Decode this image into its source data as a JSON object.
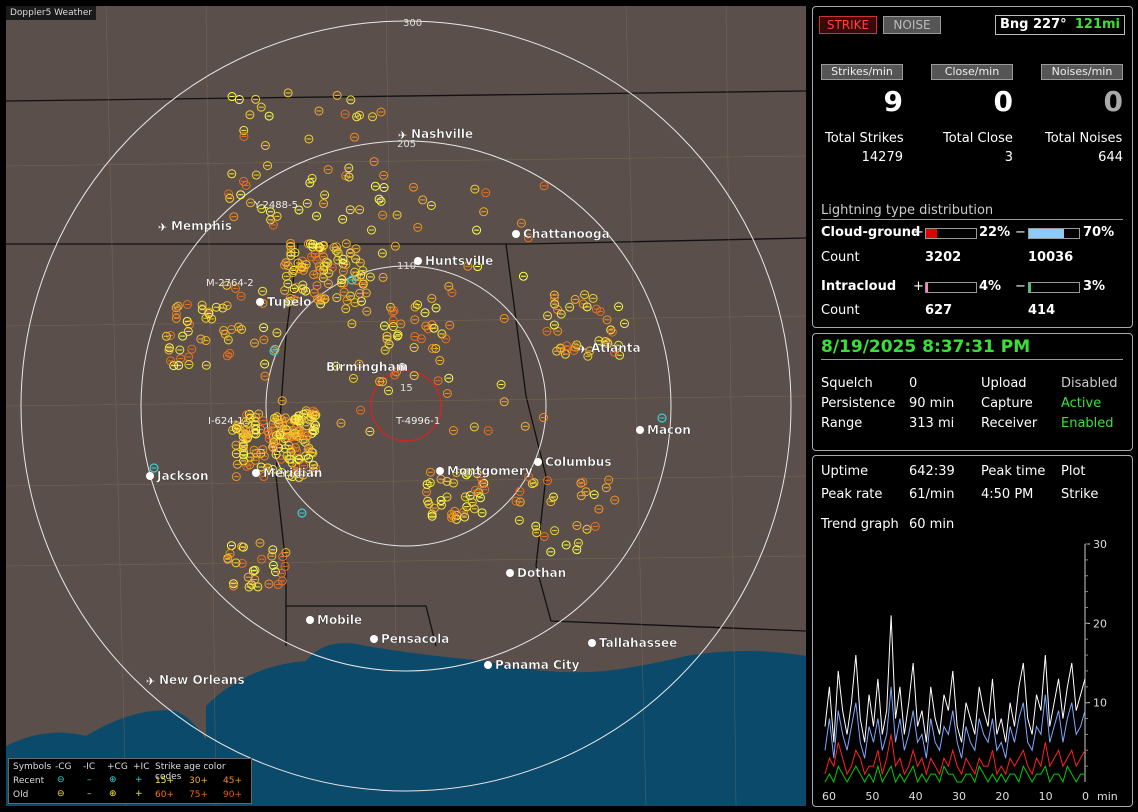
{
  "app_title": "Doppler5 Weather",
  "map": {
    "range_labels": [
      "300",
      "205",
      "110",
      "15"
    ],
    "cities": [
      {
        "name": "Nashville",
        "type": "airport"
      },
      {
        "name": "Memphis",
        "type": "airport"
      },
      {
        "name": "Chattanooga",
        "type": "city"
      },
      {
        "name": "Huntsville",
        "type": "city"
      },
      {
        "name": "Tupelo",
        "type": "city"
      },
      {
        "name": "Atlanta",
        "type": "airport"
      },
      {
        "name": "Birmingham",
        "type": "city"
      },
      {
        "name": "Macon",
        "type": "city"
      },
      {
        "name": "Jackson",
        "type": "city"
      },
      {
        "name": "Meridian",
        "type": "city"
      },
      {
        "name": "Montgomery",
        "type": "city"
      },
      {
        "name": "Columbus",
        "type": "city"
      },
      {
        "name": "Dothan",
        "type": "city"
      },
      {
        "name": "Mobile",
        "type": "city"
      },
      {
        "name": "Pensacola",
        "type": "city"
      },
      {
        "name": "Tallahassee",
        "type": "city"
      },
      {
        "name": "Panama City",
        "type": "city"
      },
      {
        "name": "New Orleans",
        "type": "airport"
      }
    ],
    "storm_tags": [
      "Y-2488-5",
      "M-2764-2",
      "I-624-1",
      "T-4996-1"
    ]
  },
  "legend": {
    "symbols_label": "Symbols",
    "columns": [
      "-CG",
      "-IC",
      "+CG",
      "+IC"
    ],
    "rows": [
      "Recent",
      "Old"
    ],
    "age_title": "Strike age color codes",
    "age_recent": [
      "15+",
      "30+",
      "45+"
    ],
    "age_old": [
      "60+",
      "75+",
      "90+"
    ],
    "glyph_minus": "⊖",
    "glyph_dash": "–",
    "glyph_plus": "⊕",
    "glyph_cross": "+"
  },
  "panel1": {
    "strike_btn": "STRIKE",
    "noise_btn": "NOISE",
    "bearing": "Bng 227°",
    "distance": "121mi",
    "rates": [
      {
        "label": "Strikes/min",
        "value": "9"
      },
      {
        "label": "Close/min",
        "value": "0"
      },
      {
        "label": "Noises/min",
        "value": "0"
      }
    ],
    "totals": [
      {
        "label": "Total Strikes",
        "value": "14279"
      },
      {
        "label": "Total Close",
        "value": "3"
      },
      {
        "label": "Total Noises",
        "value": "644"
      }
    ],
    "dist_title": "Lightning type distribution",
    "cg_label": "Cloud-ground",
    "cg_pos_pct": "22%",
    "cg_neg_pct": "70%",
    "cg_pos_frac": 0.22,
    "cg_neg_frac": 0.7,
    "count_label": "Count",
    "cg_pos_count": "3202",
    "cg_neg_count": "10036",
    "ic_label": "Intracloud",
    "ic_pos_pct": "4%",
    "ic_neg_pct": "3%",
    "ic_pos_frac": 0.04,
    "ic_neg_frac": 0.03,
    "ic_pos_count": "627",
    "ic_neg_count": "414",
    "plus": "+",
    "minus": "−"
  },
  "panel2": {
    "datetime": "8/19/2025 8:37:31 PM",
    "squelch_label": "Squelch",
    "squelch": "0",
    "persistence_label": "Persistence",
    "persistence": "90 min",
    "range_label": "Range",
    "range": "313 mi",
    "upload_label": "Upload",
    "upload": "Disabled",
    "capture_label": "Capture",
    "capture": "Active",
    "receiver_label": "Receiver",
    "receiver": "Enabled"
  },
  "panel3": {
    "uptime_label": "Uptime",
    "uptime": "642:39",
    "peak_time_label": "Peak time",
    "plot_label": "Plot",
    "peak_rate_label": "Peak rate",
    "peak_rate": "61/min",
    "peak_time": "4:50 PM",
    "plot": "Strike",
    "trend_label": "Trend graph",
    "trend": "60 min"
  },
  "chart_data": {
    "type": "line",
    "x_ticks": [
      "60",
      "50",
      "40",
      "30",
      "20",
      "10",
      "0"
    ],
    "x_unit": "min",
    "y_ticks": [
      "30",
      "20",
      "10"
    ],
    "ylim": [
      0,
      30
    ],
    "series": [
      {
        "color": "#ffffff",
        "values": [
          7,
          12,
          5,
          14,
          9,
          6,
          10,
          16,
          8,
          5,
          11,
          7,
          13,
          6,
          9,
          21,
          8,
          12,
          6,
          10,
          15,
          7,
          9,
          5,
          12,
          8,
          6,
          11,
          9,
          14,
          7,
          5,
          10,
          8,
          6,
          12,
          9,
          7,
          13,
          6,
          8,
          5,
          10,
          7,
          12,
          15,
          8,
          6,
          11,
          9,
          16,
          7,
          10,
          13,
          8,
          12,
          15,
          9,
          11,
          13
        ]
      },
      {
        "color": "#7fa7ff",
        "values": [
          4,
          8,
          3,
          9,
          6,
          4,
          7,
          10,
          5,
          3,
          7,
          5,
          8,
          4,
          6,
          12,
          5,
          8,
          4,
          6,
          9,
          5,
          6,
          3,
          8,
          5,
          4,
          7,
          6,
          9,
          5,
          3,
          7,
          5,
          4,
          8,
          6,
          5,
          8,
          4,
          5,
          3,
          7,
          5,
          8,
          10,
          5,
          4,
          7,
          6,
          11,
          5,
          7,
          9,
          5,
          8,
          10,
          6,
          7,
          9
        ]
      },
      {
        "color": "#ff2020",
        "values": [
          1,
          3,
          2,
          5,
          3,
          1,
          2,
          4,
          3,
          1,
          2,
          2,
          4,
          1,
          3,
          6,
          2,
          3,
          1,
          2,
          4,
          2,
          3,
          1,
          3,
          2,
          1,
          3,
          2,
          4,
          2,
          1,
          3,
          2,
          1,
          3,
          2,
          2,
          4,
          1,
          2,
          1,
          3,
          2,
          3,
          4,
          2,
          1,
          3,
          2,
          5,
          2,
          3,
          4,
          2,
          3,
          4,
          2,
          3,
          4
        ]
      },
      {
        "color": "#00d000",
        "values": [
          0,
          1,
          0,
          2,
          1,
          0,
          1,
          2,
          1,
          0,
          1,
          0,
          2,
          0,
          1,
          2,
          0,
          1,
          0,
          1,
          2,
          0,
          1,
          0,
          1,
          1,
          0,
          2,
          1,
          1,
          0,
          0,
          1,
          1,
          0,
          2,
          1,
          0,
          1,
          0,
          1,
          0,
          1,
          1,
          0,
          2,
          1,
          0,
          1,
          1,
          2,
          0,
          1,
          1,
          0,
          2,
          1,
          0,
          1,
          1
        ]
      }
    ]
  }
}
